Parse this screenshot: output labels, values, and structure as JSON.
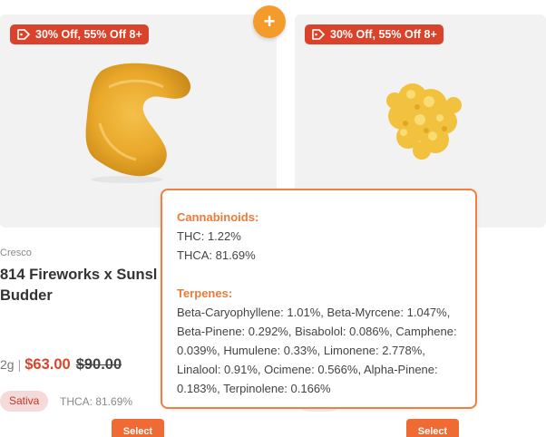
{
  "cards": [
    {
      "discount_badge": "30% Off, 55% Off 8+",
      "image_icon": "concentrate-budder-image",
      "brand": "Cresco",
      "name_line1": "814 Fireworks x Sunsl",
      "name_line2": "Budder",
      "size": "2g",
      "separator": "|",
      "sale_price": "$63.00",
      "original_price": "$90.00",
      "strain_type": "Sativa",
      "thca": "THCA: 81.69%",
      "select_label": "Select"
    },
    {
      "discount_badge": "30% Off, 55% Off 8+",
      "image_icon": "concentrate-crumble-image",
      "select_label": "Select"
    }
  ],
  "add_button_label": "+",
  "tooltip": {
    "cannabinoids_heading": "Cannabinoids:",
    "thc": "THC: 1.22%",
    "thca": "THCA: 81.69%",
    "terpenes_heading": "Terpenes:",
    "terpene_lines": [
      "Beta-Caryophyllene: 1.01%, Beta-Myrcene: 1.047%,",
      "Beta-Pinene: 0.292%, Bisabolol: 0.086%, Camphene:",
      "0.039%, Humulene: 0.33%, Limonene: 2.778%,",
      "Linalool: 0.91%, Ocimene: 0.566%, Alpha-Pinene:",
      "0.183%, Terpinolene: 0.166%"
    ]
  },
  "colors": {
    "badge": "#d9432b",
    "accent_orange": "#f06a33",
    "plus_button": "#f39c2b",
    "tooltip_border": "#f08040",
    "sale_price": "#d9432b"
  }
}
